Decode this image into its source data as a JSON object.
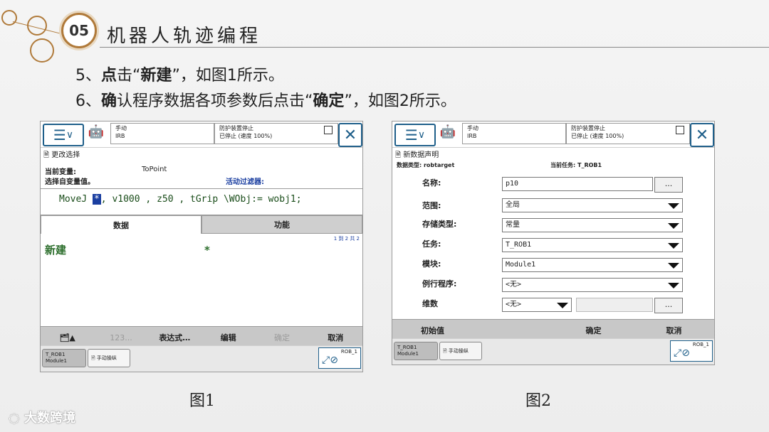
{
  "header": {
    "badge": "05",
    "title": "机器人轨迹编程"
  },
  "steps": {
    "s5_num": "5、",
    "s5_a": "点",
    "s5_b": "击“",
    "s5_c": "新建",
    "s5_d": "”，如图1所示。",
    "s6_num": "6、",
    "s6_a": "确",
    "s6_b": "认程序数据各项参数后点击“",
    "s6_c": "确定",
    "s6_d": "”，如图2所示。"
  },
  "panel1": {
    "status_left": [
      "手动",
      "IRB"
    ],
    "status_right": [
      "防护装置停止",
      "已停止 (速度 100%)"
    ],
    "breadcrumb": "更改选择",
    "current_var_label": "当前变量:",
    "current_var_value": "ToPoint",
    "select_label": "选择自变量值。",
    "filter_label": "活动过滤器:",
    "code_prefix": "MoveJ ",
    "code_cursor": "*",
    "code_suffix": ", v1000 , z50 , tGrip \\WObj:= wobj1;",
    "tab_data": "数据",
    "tab_func": "功能",
    "page_info": "1 到 2 共 2",
    "item_new": "新建",
    "item_star": "*",
    "toolbar": [
      "123...",
      "表达式…",
      "编辑",
      "确定",
      "取消"
    ],
    "task_btn1": [
      "T_ROB1",
      "Module1"
    ],
    "task_btn2": "手动操纵",
    "rob": "ROB_1"
  },
  "panel2": {
    "status_left": [
      "手动",
      "IRB"
    ],
    "status_right": [
      "防护装置停止",
      "已停止 (速度 100%)"
    ],
    "breadcrumb": "新数据声明",
    "datatype_label": "数据类型: robtarget",
    "task_label": "当前任务:  T_ROB1",
    "fields": [
      {
        "label": "名称:",
        "value": "p10"
      },
      {
        "label": "范围:",
        "value": "全局"
      },
      {
        "label": "存储类型:",
        "value": "常量"
      },
      {
        "label": "任务:",
        "value": "T_ROB1"
      },
      {
        "label": "模块:",
        "value": "Module1"
      },
      {
        "label": "例行程序:",
        "value": "<无>"
      },
      {
        "label": "维数",
        "value": "<无>"
      }
    ],
    "dots": "...",
    "toolbar": [
      "初始值",
      "确定",
      "取消"
    ],
    "task_btn1": [
      "T_ROB1",
      "Module1"
    ],
    "task_btn2": "手动操纵",
    "rob": "ROB_1"
  },
  "captions": {
    "fig1": "图1",
    "fig2": "图2"
  },
  "watermark": "大数跨境"
}
